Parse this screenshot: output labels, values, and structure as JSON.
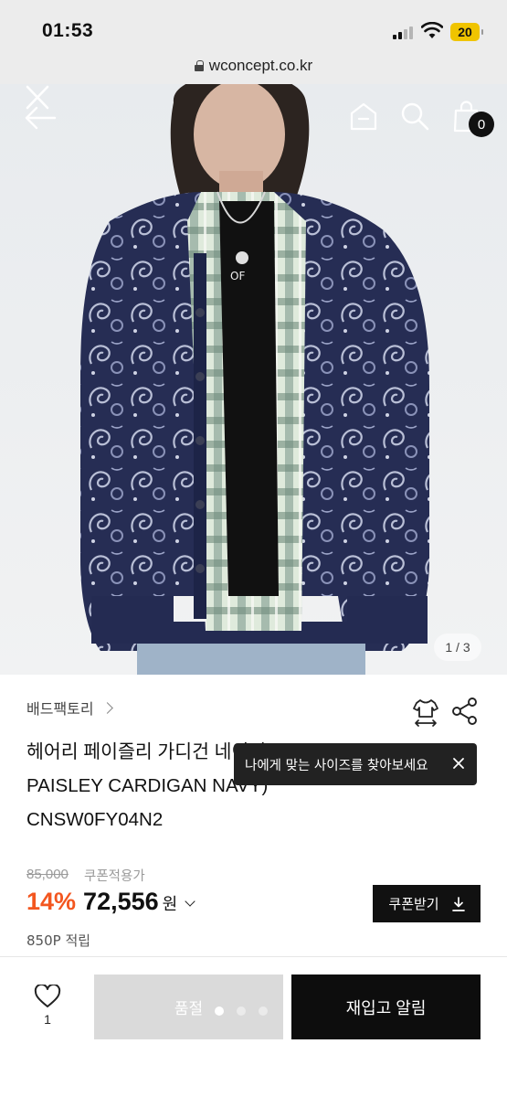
{
  "status_bar": {
    "time": "01:53",
    "battery": "20"
  },
  "browser": {
    "url": "wconcept.co.kr"
  },
  "hero": {
    "cart_count": "0",
    "page_indicator": "1 / 3",
    "icons": [
      "close-icon",
      "back-arrow-icon",
      "home-icon",
      "search-icon",
      "shopping-bag-icon"
    ]
  },
  "product": {
    "brand": "배드팩토리",
    "title": "헤어리 페이즐리 가디건 네이비 (HAIRY PAISLEY CARDIGAN NAVY)",
    "code": "CNSW0FY04N2",
    "tooltip": "나에게 맞는 사이즈를 찾아보세요",
    "original_price": "85,000",
    "coupon_applied": "쿠폰적용가",
    "discount": "14%",
    "price": "72,556",
    "currency": "원",
    "coupon_button": "쿠폰받기",
    "points": "850P 적립"
  },
  "actions": {
    "like_count": "1",
    "soldout_label": "품절",
    "restock_label": "재입고 알림"
  },
  "colors": {
    "accent": "#f3561f",
    "dark": "#111111",
    "disabled": "#dadada"
  }
}
